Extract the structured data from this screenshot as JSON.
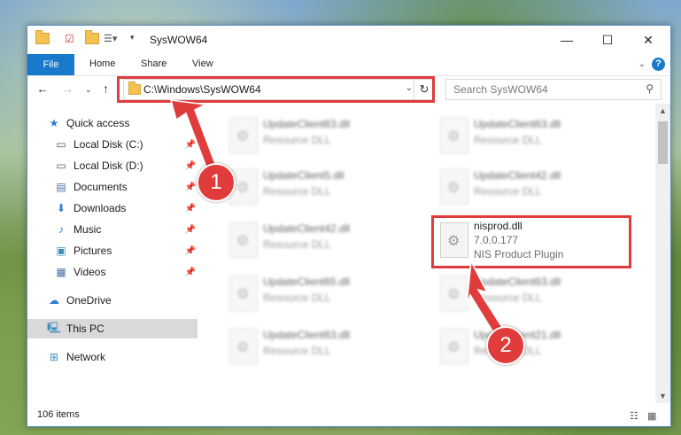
{
  "window": {
    "title": "SysWOW64",
    "controls": {
      "minimize": "—",
      "maximize": "☐",
      "close": "✕"
    }
  },
  "ribbon": {
    "file_label": "File",
    "tabs": [
      "Home",
      "Share",
      "View"
    ]
  },
  "nav": {
    "address": "C:\\Windows\\SysWOW64",
    "search_placeholder": "Search SysWOW64"
  },
  "sidebar": {
    "items": [
      {
        "label": "Quick access",
        "icon": "star-icon"
      },
      {
        "label": "Local Disk (C:)",
        "icon": "drive-icon"
      },
      {
        "label": "Local Disk (D:)",
        "icon": "drive-icon"
      },
      {
        "label": "Documents",
        "icon": "documents-icon"
      },
      {
        "label": "Downloads",
        "icon": "downloads-icon"
      },
      {
        "label": "Music",
        "icon": "music-icon"
      },
      {
        "label": "Pictures",
        "icon": "pictures-icon"
      },
      {
        "label": "Videos",
        "icon": "videos-icon"
      },
      {
        "label": "OneDrive",
        "icon": "cloud-icon"
      },
      {
        "label": "This PC",
        "icon": "computer-icon"
      },
      {
        "label": "Network",
        "icon": "network-icon"
      }
    ]
  },
  "files": [
    {
      "name": "UpdateClient63.dll",
      "type": "Resource DLL"
    },
    {
      "name": "UpdateClient63.dll",
      "type": "Resource DLL"
    },
    {
      "name": "UpdateClient5.dll",
      "type": "Resource DLL"
    },
    {
      "name": "UpdateClient42.dll",
      "type": "Resource DLL"
    },
    {
      "name": "UpdateClient42.dll",
      "type": "Resource DLL"
    },
    {
      "name": "nisprod.dll",
      "version": "7.0.0.177",
      "type": "NIS Product Plugin"
    },
    {
      "name": "UpdateClient65.dll",
      "type": "Resource DLL"
    },
    {
      "name": "UpdateClient63.dll",
      "type": "Resource DLL"
    },
    {
      "name": "UpdateClient63.dll",
      "type": "Resource DLL"
    },
    {
      "name": "UpdateClient21.dll",
      "type": "Resource DLL"
    }
  ],
  "status": {
    "item_count": "106 items"
  },
  "annotations": {
    "step1": "1",
    "step2": "2",
    "highlight_color": "#e03c3c"
  }
}
